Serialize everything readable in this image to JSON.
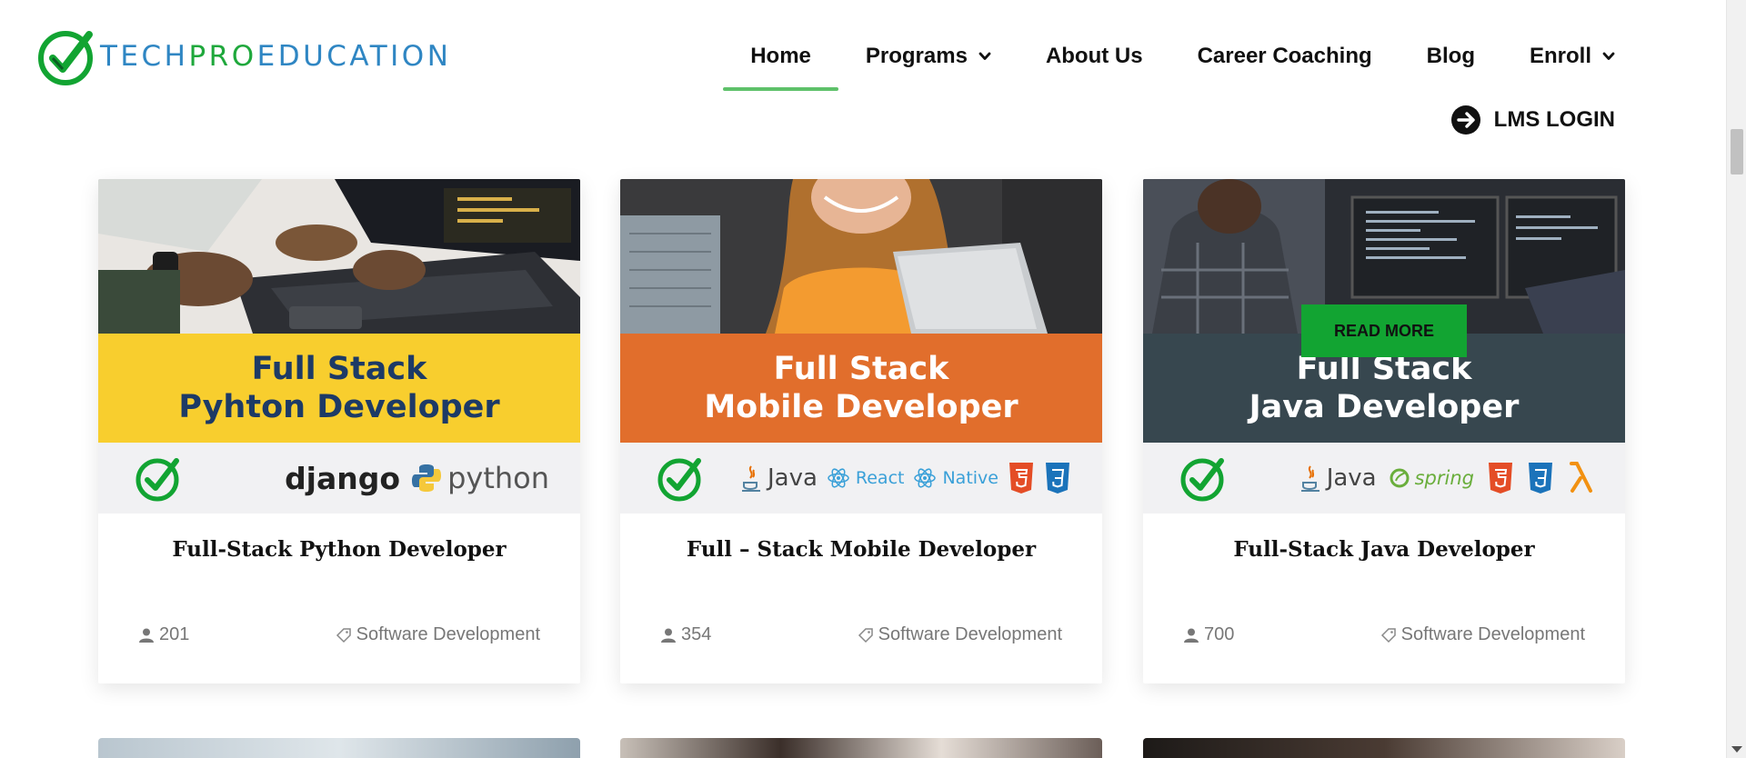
{
  "header": {
    "logo": {
      "part1": "TECH",
      "part2": "PRO",
      "part3": "EDUCATION"
    },
    "nav": [
      {
        "label": "Home",
        "active": true,
        "dropdown": false
      },
      {
        "label": "Programs",
        "active": false,
        "dropdown": true
      },
      {
        "label": "About Us",
        "active": false,
        "dropdown": false
      },
      {
        "label": "Career Coaching",
        "active": false,
        "dropdown": false
      },
      {
        "label": "Blog",
        "active": false,
        "dropdown": false
      },
      {
        "label": "Enroll",
        "active": false,
        "dropdown": true
      }
    ],
    "lms_login": "LMS LOGIN"
  },
  "colors": {
    "brand_green": "#12a432",
    "brand_blue": "#2f86c3",
    "active_underline": "#5ec16a"
  },
  "courses": [
    {
      "banner_line1": "Full Stack",
      "banner_line2": "Pyhton Developer",
      "tech": [
        "django",
        "python"
      ],
      "title": "Full-Stack Python Developer",
      "students": "201",
      "category": "Software Development"
    },
    {
      "banner_line1": "Full Stack",
      "banner_line2": "Mobile Developer",
      "tech": [
        "Java",
        "React",
        "Native"
      ],
      "title": "Full – Stack Mobile Developer",
      "students": "354",
      "category": "Software Development"
    },
    {
      "banner_line1": "Full Stack",
      "banner_line2": "Java Developer",
      "tech": [
        "Java",
        "spring"
      ],
      "title": "Full-Stack Java Developer",
      "students": "700",
      "category": "Software Development",
      "read_more": "READ MORE"
    }
  ]
}
